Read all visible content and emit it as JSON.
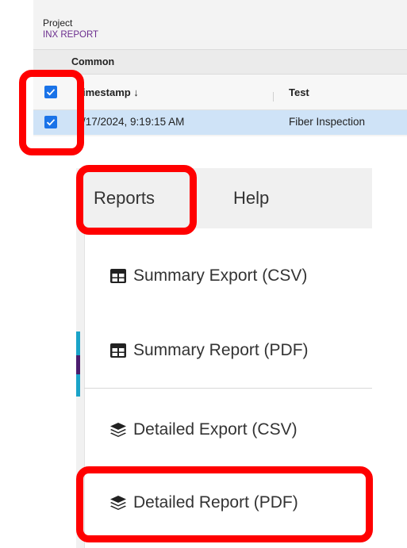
{
  "project": {
    "label": "Project",
    "name": "INX REPORT"
  },
  "table": {
    "group_label": "Common",
    "columns": [
      "imestamp ↓",
      "Test"
    ],
    "rows": [
      {
        "timestamp": "/17/2024, 9:19:15 AM",
        "test": "Fiber Inspection",
        "selected": true
      }
    ]
  },
  "menubar": {
    "tabs": [
      "Reports",
      "Help"
    ]
  },
  "reports_menu": {
    "items": [
      {
        "label": "Summary Export (CSV)",
        "icon": "table-icon"
      },
      {
        "label": "Summary Report (PDF)",
        "icon": "table-icon"
      },
      {
        "label": "Detailed Export (CSV)",
        "icon": "layers-icon"
      },
      {
        "label": "Detailed Report (PDF)",
        "icon": "layers-icon"
      }
    ]
  },
  "colors": {
    "highlight": "#ff0000",
    "checkbox": "#1a73e8",
    "selected_row": "#cfe3f7",
    "project_name": "#6b2d8e",
    "accent_teal": "#1aa3c8",
    "accent_purple": "#4b1c6e"
  }
}
